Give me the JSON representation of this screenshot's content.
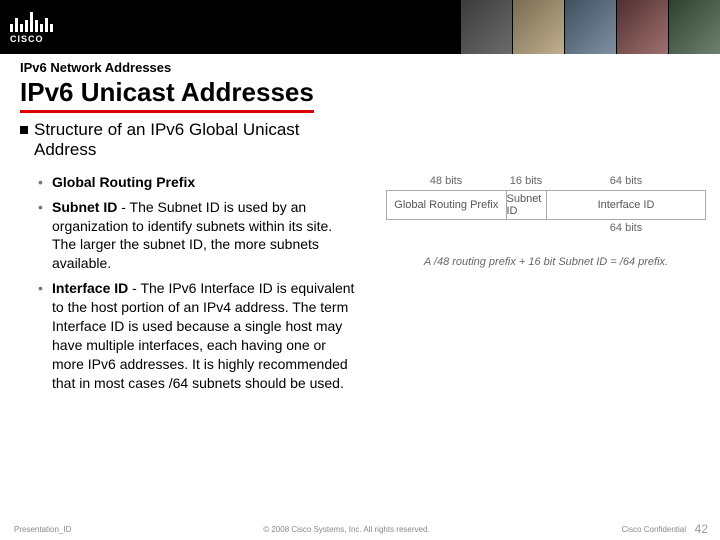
{
  "header": {
    "logo_text": "CISCO"
  },
  "titleblock": {
    "overline": "IPv6 Network Addresses",
    "title": "IPv6 Unicast Addresses"
  },
  "section": {
    "heading": "Structure of an IPv6 Global Unicast Address",
    "bullets": [
      {
        "lead": "",
        "label": "Global Routing Prefix",
        "rest": ""
      },
      {
        "lead": "",
        "label": "Subnet ID",
        "rest": " - The Subnet ID is used by an organization to identify subnets within its site. The larger the subnet ID, the more subnets available."
      },
      {
        "lead": "",
        "label": "Interface ID",
        "rest": " - The IPv6 Interface ID is equivalent to the host portion of an IPv4 address. The term Interface ID is used because a single host may have multiple interfaces, each having one or more IPv6 addresses. It is highly recommended that in most cases /64 subnets should be used."
      }
    ]
  },
  "diagram": {
    "bits": {
      "l": "48 bits",
      "m": "16 bits",
      "r": "64 bits"
    },
    "boxes": {
      "l": "Global Routing Prefix",
      "m": "Subnet ID",
      "r": "Interface ID"
    },
    "under_right": "64 bits",
    "caption": "A /48 routing prefix + 16 bit Subnet ID = /64 prefix."
  },
  "footer": {
    "id": "Presentation_ID",
    "copyright": "© 2008 Cisco Systems, Inc. All rights reserved.",
    "confidential": "Cisco Confidential",
    "page": "42"
  }
}
